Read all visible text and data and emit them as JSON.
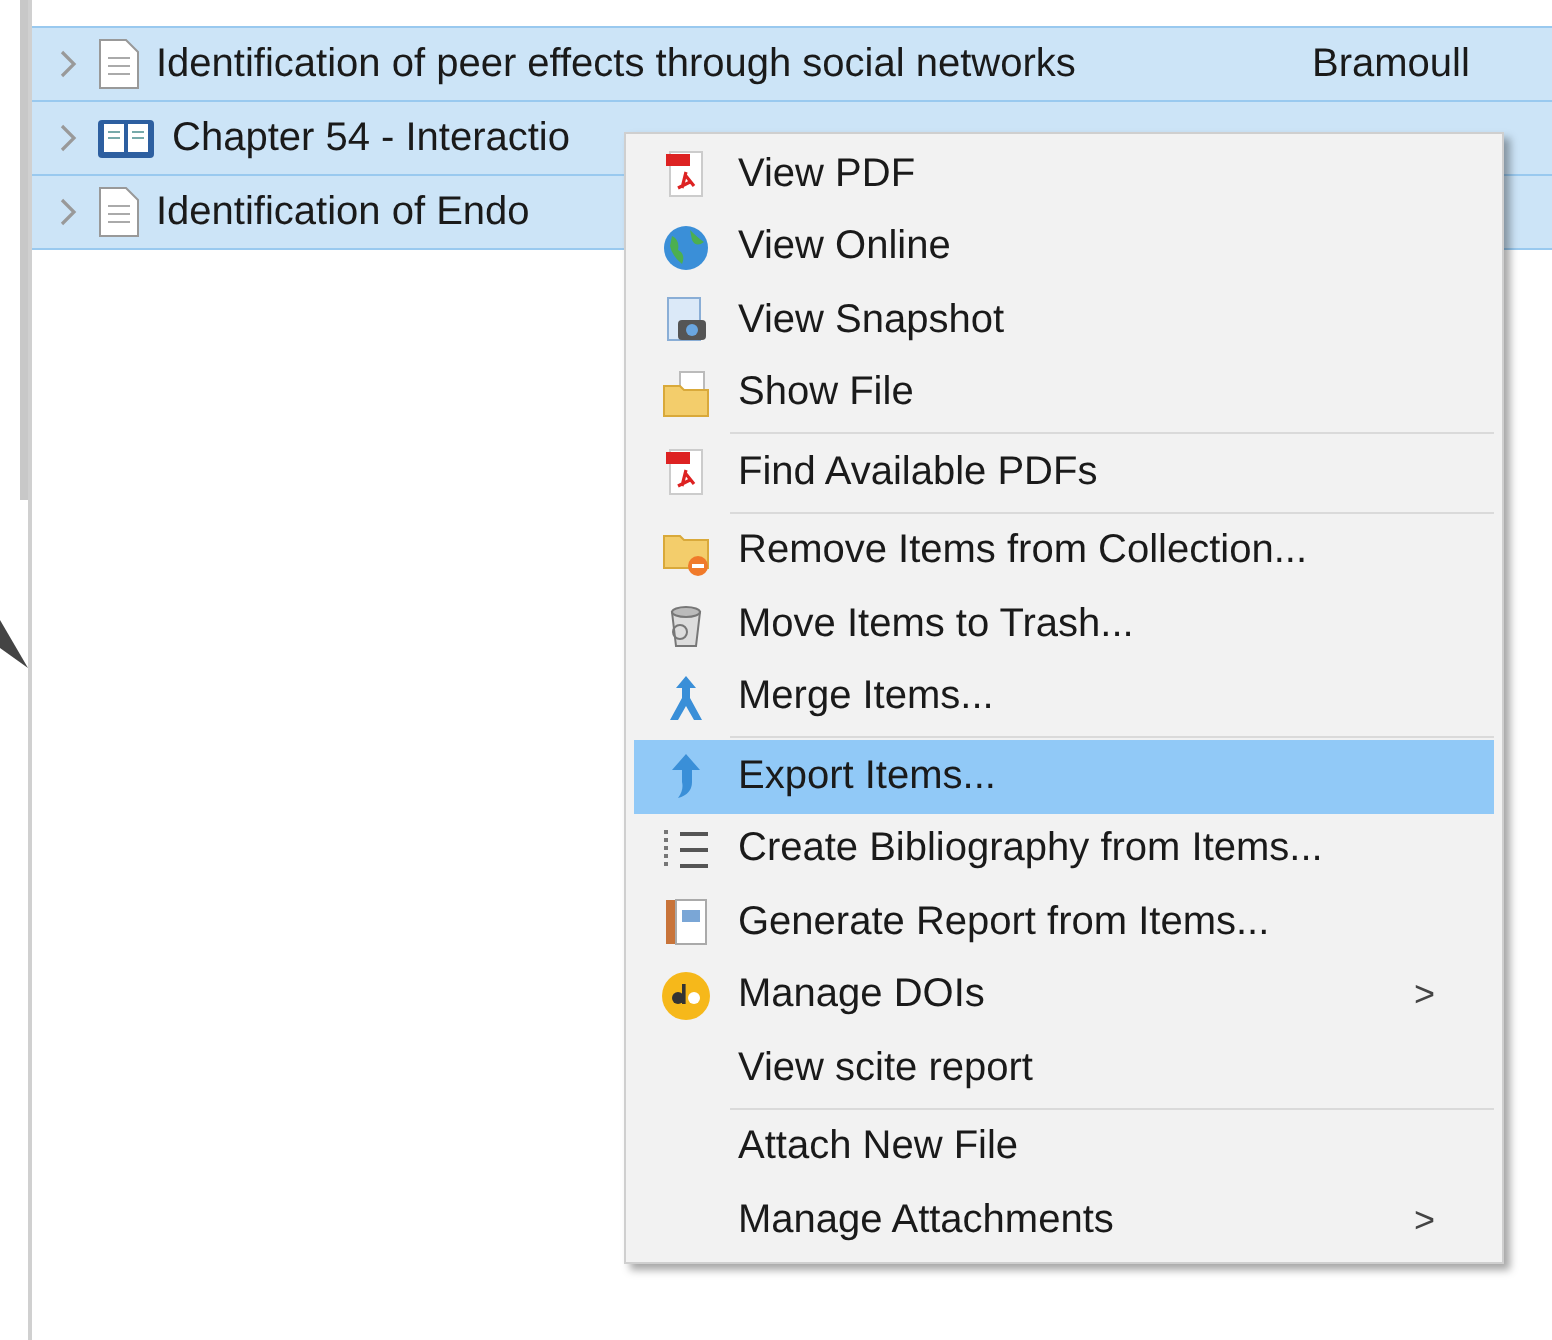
{
  "rows": [
    {
      "kind": "document",
      "title": "Identification of peer effects through social networks",
      "creator": "Bramoull",
      "selected": true,
      "expanded": false
    },
    {
      "kind": "book",
      "title": "Chapter 54 - Interactio",
      "selected": true,
      "expanded": false
    },
    {
      "kind": "document",
      "title": "Identification of Endo",
      "selected": true,
      "expanded": false
    }
  ],
  "context_menu": {
    "groups": [
      [
        {
          "label": "View PDF",
          "selected": false
        },
        {
          "label": "View Online",
          "selected": false
        },
        {
          "label": "View Snapshot",
          "selected": false
        },
        {
          "label": "Show File",
          "selected": false
        }
      ],
      [
        {
          "label": "Find Available PDFs",
          "selected": false
        }
      ],
      [
        {
          "label": "Remove Items from Collection...",
          "selected": false
        },
        {
          "label": "Move Items to Trash...",
          "selected": false
        },
        {
          "label": "Merge Items...",
          "selected": false
        }
      ],
      [
        {
          "label": "Export Items...",
          "selected": true
        },
        {
          "label": "Create Bibliography from Items...",
          "selected": false
        },
        {
          "label": "Generate Report from Items...",
          "selected": false
        },
        {
          "label": "Manage DOIs",
          "selected": false,
          "arrow": ">"
        },
        {
          "label": "View scite report",
          "selected": false
        }
      ],
      [
        {
          "label": "Attach New File",
          "selected": false
        },
        {
          "label": "Manage Attachments",
          "selected": false,
          "arrow": ">"
        }
      ]
    ]
  }
}
